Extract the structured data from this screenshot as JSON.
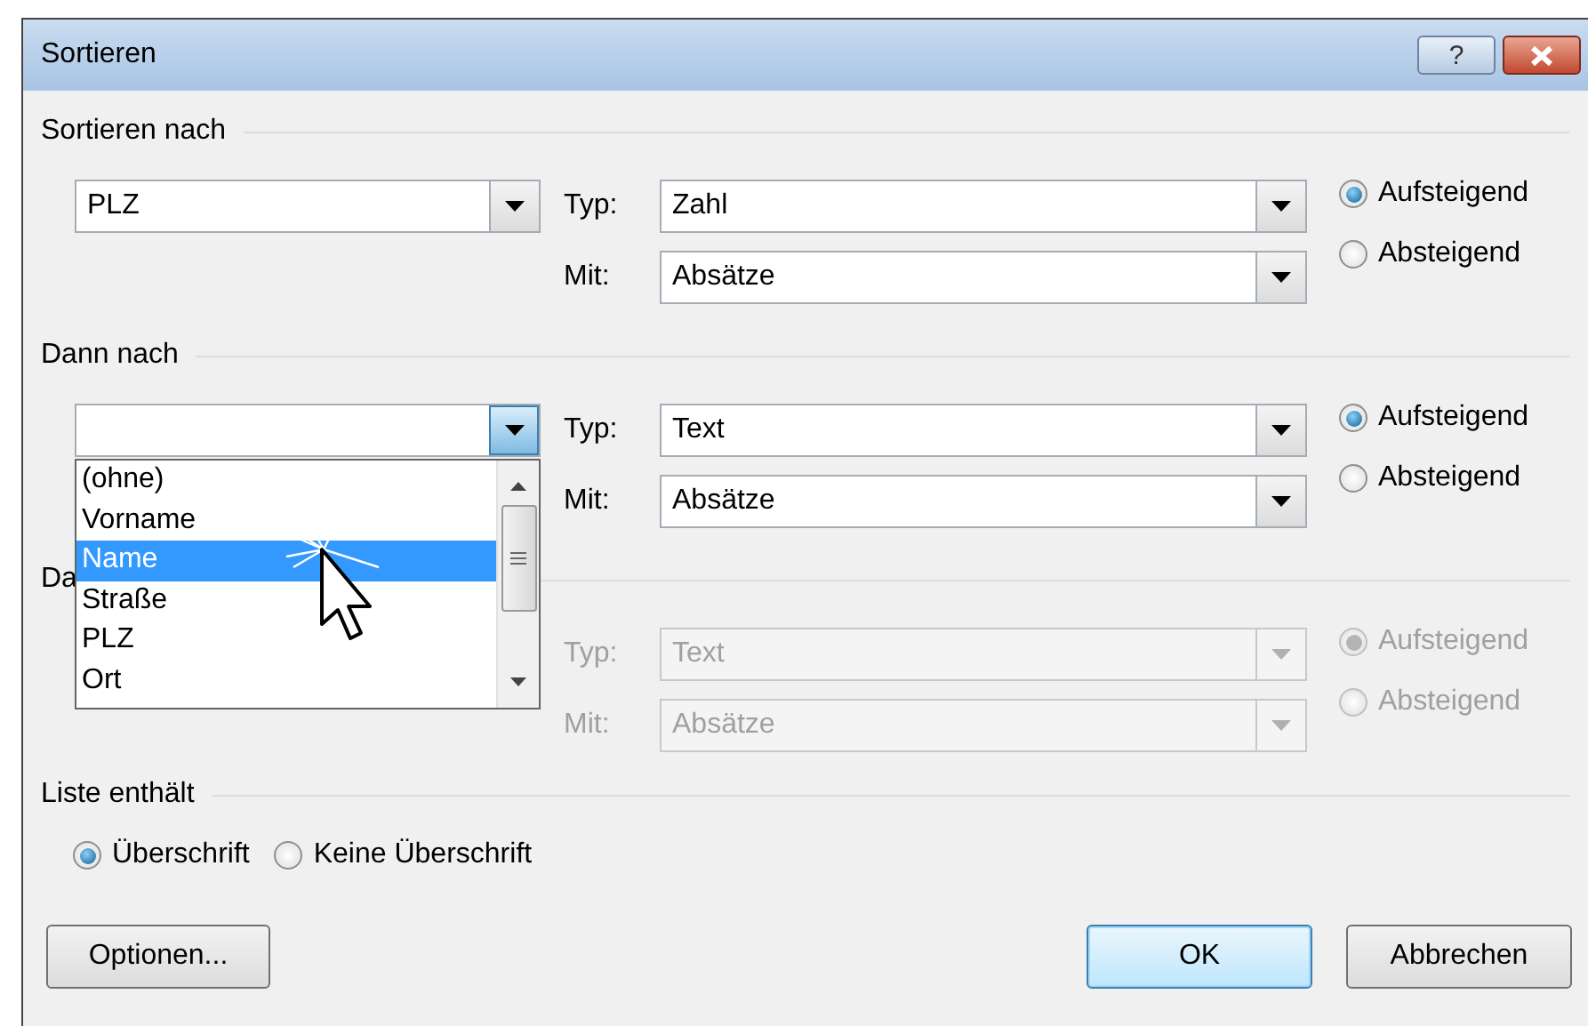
{
  "window": {
    "title": "Sortieren"
  },
  "title_buttons": [
    {
      "kind": "help",
      "label": "?"
    },
    {
      "kind": "close"
    }
  ],
  "sections": [
    {
      "title": "Sortieren nach",
      "disabled": false,
      "field": {
        "value": "PLZ",
        "hovered": false
      },
      "type": {
        "label": "Typ:",
        "value": "Zahl"
      },
      "with": {
        "label": "Mit:",
        "value": "Absätze"
      },
      "order": [
        {
          "label": "Aufsteigend",
          "selected": true
        },
        {
          "label": "Absteigend",
          "selected": false
        }
      ]
    },
    {
      "title": "Dann nach",
      "disabled": false,
      "field": {
        "hovered": true
      },
      "type": {
        "label": "Typ:",
        "value": "Text"
      },
      "with": {
        "label": "Mit:",
        "value": "Absätze"
      },
      "order": [
        {
          "label": "Aufsteigend",
          "selected": true
        },
        {
          "label": "Absteigend",
          "selected": false
        }
      ]
    },
    {
      "title": "Da",
      "disabled": true,
      "type": {
        "label": "Typ:",
        "value": "Text"
      },
      "with": {
        "label": "Mit:",
        "value": "Absätze"
      },
      "order": [
        {
          "label": "Aufsteigend",
          "selected": true
        },
        {
          "label": "Absteigend",
          "selected": false
        }
      ]
    }
  ],
  "dropdown_list": {
    "items": [
      {
        "label": "(ohne)",
        "selected": false
      },
      {
        "label": "Vorname",
        "selected": false
      },
      {
        "label": "Name",
        "selected": true
      },
      {
        "label": "Straße",
        "selected": false
      },
      {
        "label": "PLZ",
        "selected": false
      },
      {
        "label": "Ort",
        "selected": false
      }
    ]
  },
  "list_contains": {
    "title": "Liste enthält",
    "options": [
      {
        "label": "Überschrift",
        "selected": true
      },
      {
        "label": "Keine Überschrift",
        "selected": false
      }
    ]
  },
  "buttons": [
    {
      "label": "Optionen...",
      "default": false
    },
    {
      "label": "OK",
      "default": true
    },
    {
      "label": "Abbrechen",
      "default": false
    }
  ]
}
